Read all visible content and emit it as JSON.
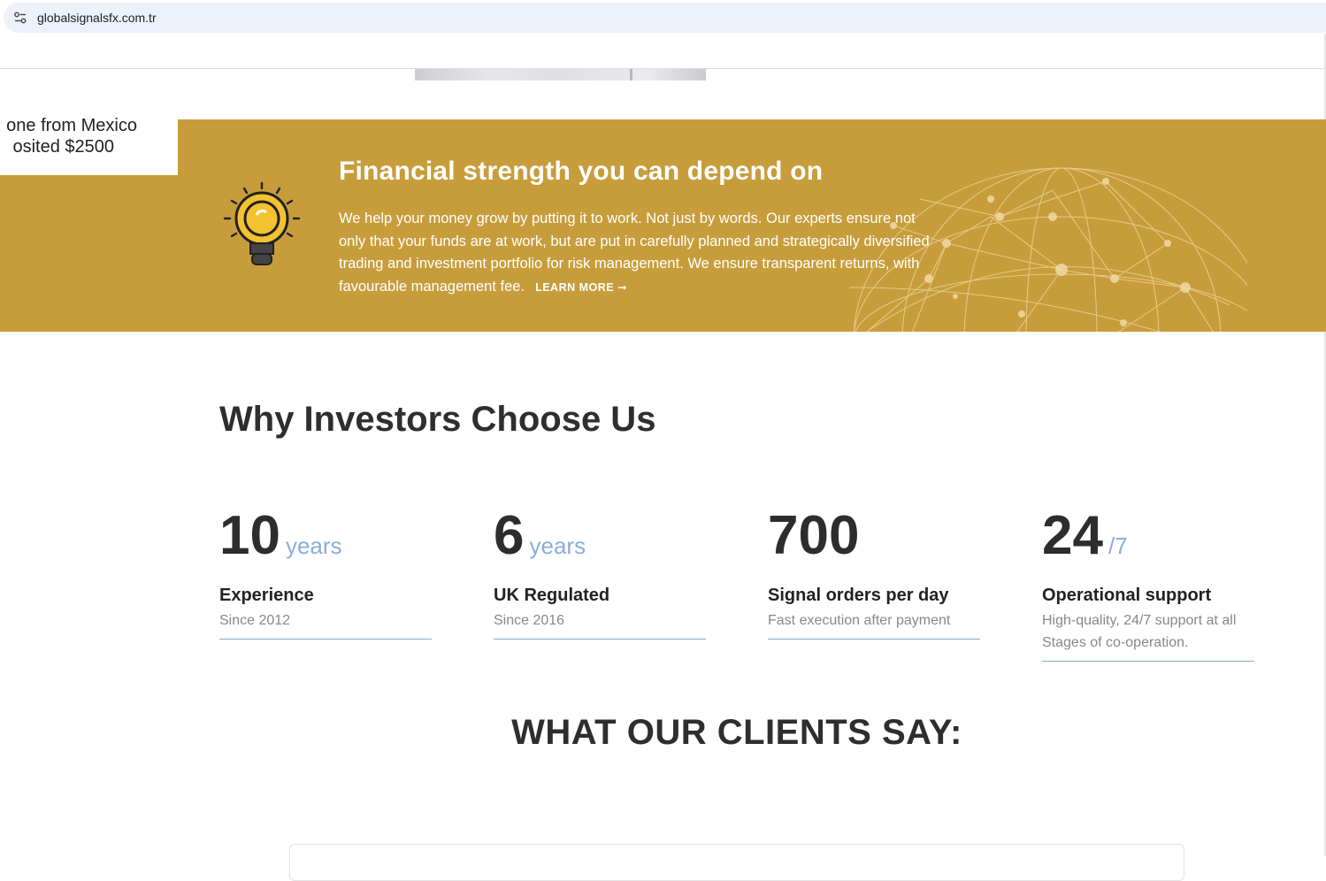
{
  "browser": {
    "url": "globalsignalsfx.com.tr"
  },
  "notification": {
    "line1": "one from Mexico",
    "line2": "osited $2500"
  },
  "band": {
    "title": "Financial strength you can depend on",
    "text": "We help your money grow by putting it to work. Not just by words. Our experts ensure not only that your funds are at work, but are put in carefully planned and strategically diversified trading and investment portfolio for risk management. We ensure transparent returns, with favourable management fee.",
    "learn_more": "LEARN MORE",
    "arrow": "➞",
    "color": "#c79d3c"
  },
  "why": {
    "title": "Why Investors Choose Us",
    "stats": [
      {
        "number": "10",
        "unit": "years",
        "label": "Experience",
        "sub": "Since 2012"
      },
      {
        "number": "6",
        "unit": "years",
        "label": "UK Regulated",
        "sub": "Since 2016"
      },
      {
        "number": "700",
        "unit": "",
        "label": "Signal orders per day",
        "sub": "Fast execution after payment"
      },
      {
        "number": "24",
        "unit": "/7",
        "label": "Operational support",
        "sub": "High-quality, 24/7 support at all Stages of co-operation."
      }
    ]
  },
  "clients": {
    "title": "WHAT OUR CLIENTS SAY:"
  },
  "icons": {
    "site_info": "site-settings-icon",
    "bulb": "lightbulb-icon",
    "arrow": "arrow-right-icon"
  }
}
